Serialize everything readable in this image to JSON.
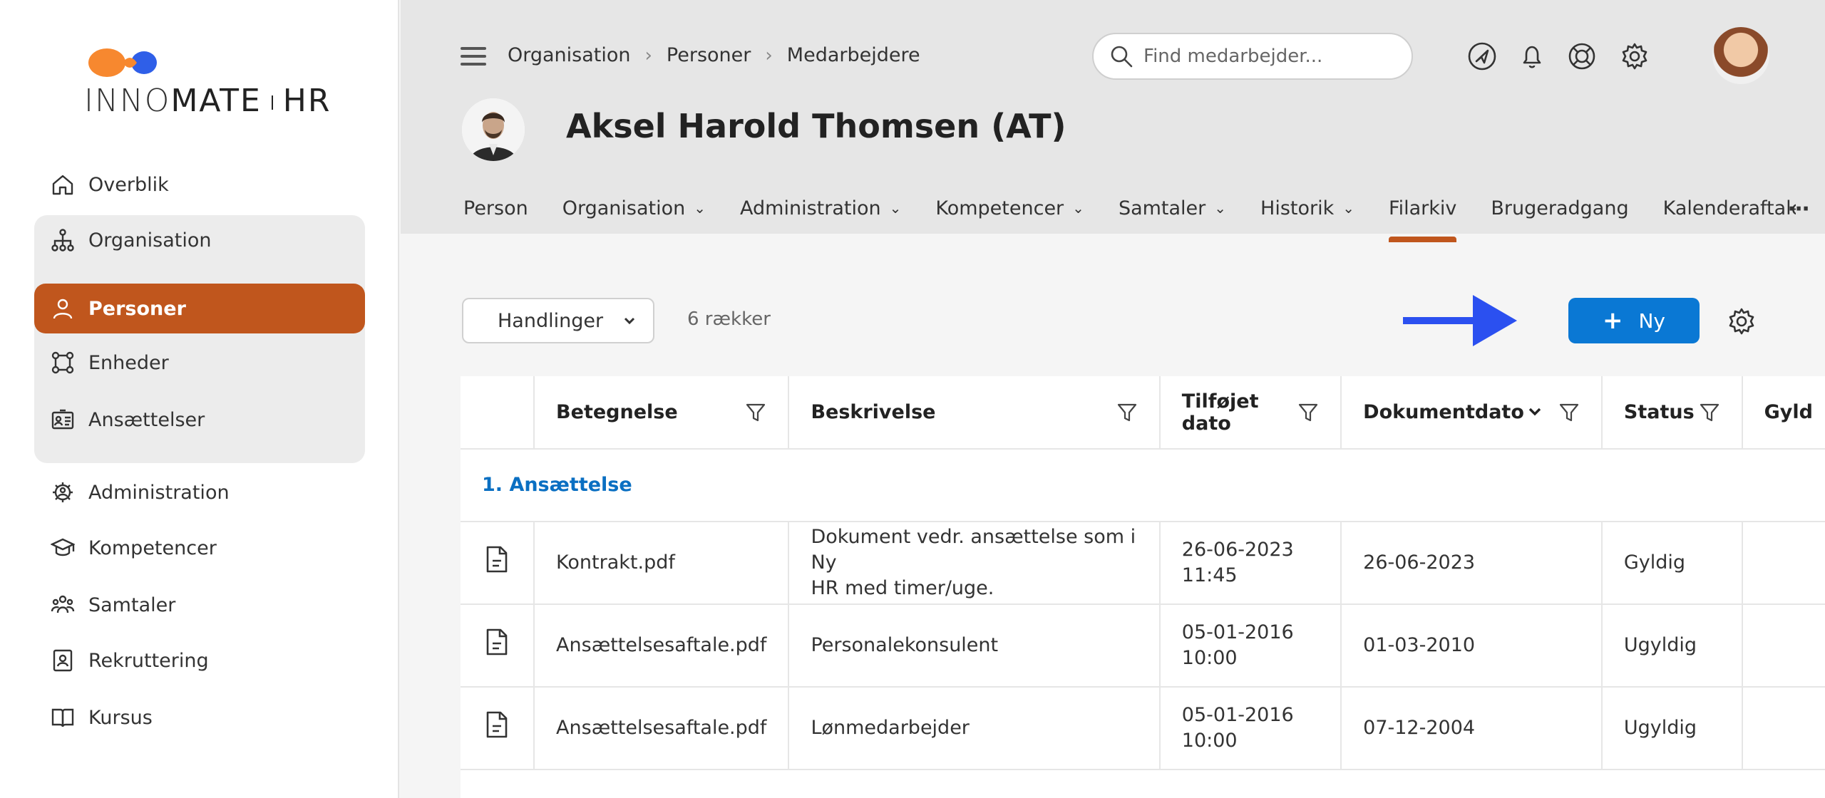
{
  "app": {
    "brand_left": "INNO",
    "brand_mid": "MATE",
    "brand_right": "HR"
  },
  "sidebar": {
    "items": [
      {
        "label": "Overblik",
        "icon": "home-icon"
      },
      {
        "label": "Organisation",
        "icon": "org-chart-icon"
      },
      {
        "label": "Personer",
        "icon": "person-icon"
      },
      {
        "label": "Enheder",
        "icon": "units-icon"
      },
      {
        "label": "Ansættelser",
        "icon": "id-card-icon"
      },
      {
        "label": "Administration",
        "icon": "admin-gear-icon"
      },
      {
        "label": "Kompetencer",
        "icon": "graduation-cap-icon"
      },
      {
        "label": "Samtaler",
        "icon": "people-group-icon"
      },
      {
        "label": "Rekruttering",
        "icon": "badge-icon"
      },
      {
        "label": "Kursus",
        "icon": "book-icon"
      }
    ],
    "active": "Personer"
  },
  "header": {
    "breadcrumb": [
      "Organisation",
      "Personer",
      "Medarbejdere"
    ],
    "search_placeholder": "Find medarbejder...",
    "person_name": "Aksel Harold Thomsen (AT)",
    "tabs": [
      {
        "label": "Person",
        "dropdown": false
      },
      {
        "label": "Organisation",
        "dropdown": true
      },
      {
        "label": "Administration",
        "dropdown": true
      },
      {
        "label": "Kompetencer",
        "dropdown": true
      },
      {
        "label": "Samtaler",
        "dropdown": true
      },
      {
        "label": "Historik",
        "dropdown": true
      },
      {
        "label": "Filarkiv",
        "dropdown": false
      },
      {
        "label": "Brugeradgang",
        "dropdown": false
      },
      {
        "label": "Kalenderaftaler",
        "dropdown": false
      }
    ],
    "active_tab": "Filarkiv"
  },
  "toolbar": {
    "actions_label": "Handlinger",
    "rows_count": "6 rækker",
    "new_label": "Ny"
  },
  "table": {
    "columns": [
      "Betegnelse",
      "Beskrivelse",
      "Tilføjet dato",
      "Dokumentdato",
      "Status",
      "Gyld"
    ],
    "group": "1. Ansættelse",
    "rows": [
      {
        "name": "Kontrakt.pdf",
        "desc_1": "Dokument vedr. ansættelse som i Ny",
        "desc_2": "HR med timer/uge.",
        "added_1": "26-06-2023",
        "added_2": "11:45",
        "docdate": "26-06-2023",
        "status": "Gyldig"
      },
      {
        "name": "Ansættelsesaftale.pdf",
        "desc_1": "Personalekonsulent",
        "desc_2": "",
        "added_1": "05-01-2016",
        "added_2": "10:00",
        "docdate": "01-03-2010",
        "status": "Ugyldig"
      },
      {
        "name": "Ansættelsesaftale.pdf",
        "desc_1": "Lønmedarbejder",
        "desc_2": "",
        "added_1": "05-01-2016",
        "added_2": "10:00",
        "docdate": "07-12-2004",
        "status": "Ugyldig"
      }
    ]
  },
  "colors": {
    "accent_orange": "#c0561d",
    "primary_blue": "#0a78d4",
    "arrow_blue": "#2b50f0"
  }
}
